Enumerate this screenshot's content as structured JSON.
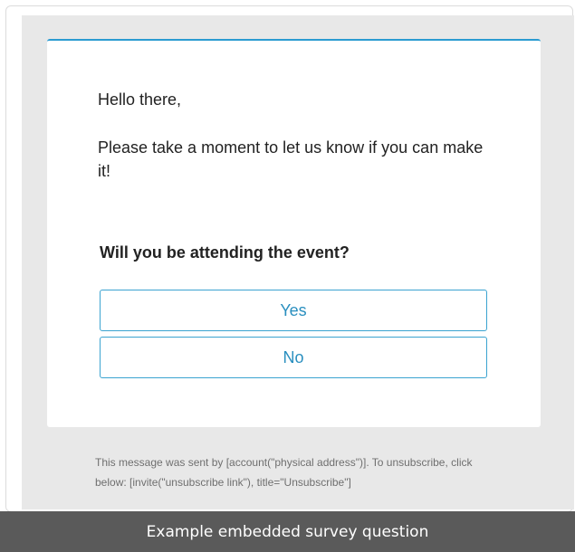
{
  "email": {
    "greeting": "Hello there,",
    "intro": "Please take a moment to let us know if you can make it!",
    "question": "Will you be attending the event?",
    "answers": [
      "Yes",
      "No"
    ],
    "footer": "This message was sent by [account(\"physical address\")]. To unsubscribe, click below: [invite(\"unsubscribe link\"), title=\"Unsubscribe\"]"
  },
  "caption": "Example embedded survey question",
  "colors": {
    "accent": "#2a9bd1",
    "caption_bg": "#5a5a5a",
    "email_bg": "#e8e8e8"
  }
}
